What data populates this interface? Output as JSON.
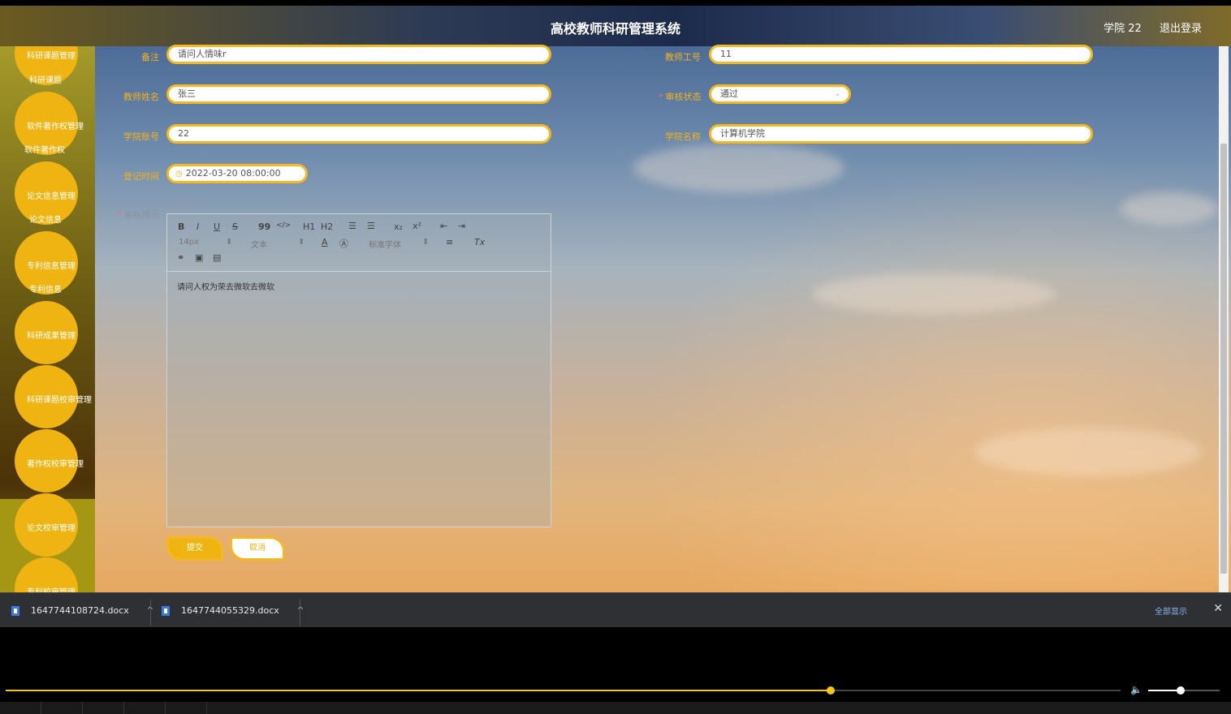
{
  "header": {
    "title": "高校教师科研管理系统",
    "user": "学院 22",
    "logout": "退出登录"
  },
  "sidebar": {
    "items": [
      {
        "circle": "科研课题管理",
        "sub": "科研课题"
      },
      {
        "circle": "软件著作权管理",
        "sub": "软件著作权"
      },
      {
        "circle": "论文信息管理",
        "sub": "论文信息"
      },
      {
        "circle": "专利信息管理",
        "sub": "专利信息"
      },
      {
        "circle": "科研成果管理"
      },
      {
        "circle": "科研课题校审管理"
      },
      {
        "circle": "著作权校审管理"
      },
      {
        "circle": "论文校审管理"
      },
      {
        "circle": "专利校审管理"
      }
    ]
  },
  "form": {
    "remark": {
      "label": "备注",
      "value": "请问人情味r"
    },
    "teacher_id": {
      "label": "教师工号",
      "value": "11"
    },
    "teacher_name": {
      "label": "教师姓名",
      "value": "张三"
    },
    "review_status": {
      "label": "审核状态",
      "value": "通过"
    },
    "college_account": {
      "label": "学院账号",
      "value": "22"
    },
    "college_name": {
      "label": "学院名称",
      "value": "计算机学院"
    },
    "register_time": {
      "label": "登记时间",
      "value": "2022-03-20 08:00:00"
    },
    "review_detail": {
      "label": "审核情况"
    }
  },
  "editor": {
    "toolbar": {
      "bold": "B",
      "italic": "I",
      "underline": "U",
      "strike": "S",
      "quote": "99",
      "code": "</>",
      "h1": "H1",
      "h2": "H2",
      "sub": "x₂",
      "sup": "x²",
      "font_size": "14px",
      "text_type": "文本",
      "font_family": "标准字体",
      "clear": "Tx"
    },
    "content": "请问人权为荣去微软去微软"
  },
  "buttons": {
    "submit": "提交",
    "cancel": "取消"
  },
  "downloads": {
    "items": [
      {
        "name": "1647744108724.docx"
      },
      {
        "name": "1647744055329.docx"
      }
    ],
    "show_all": "全部显示",
    "close": "✕"
  },
  "player": {
    "progress": 0.74,
    "volume": 0.45
  }
}
